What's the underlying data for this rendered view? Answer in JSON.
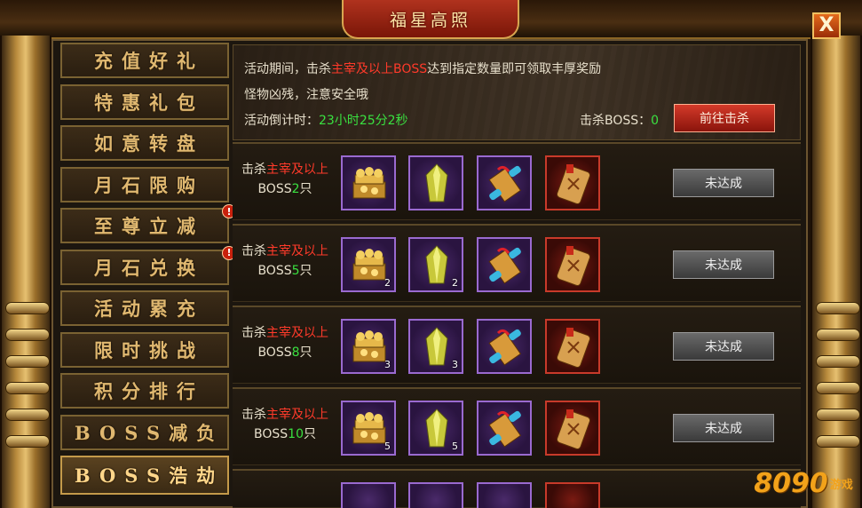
{
  "title": "福星高照",
  "close_label": "X",
  "sidebar": {
    "items": [
      {
        "label": "充值好礼",
        "alert": false,
        "active": false
      },
      {
        "label": "特惠礼包",
        "alert": false,
        "active": false
      },
      {
        "label": "如意转盘",
        "alert": false,
        "active": false
      },
      {
        "label": "月石限购",
        "alert": false,
        "active": false
      },
      {
        "label": "至尊立减",
        "alert": true,
        "active": false
      },
      {
        "label": "月石兑换",
        "alert": true,
        "active": false
      },
      {
        "label": "活动累充",
        "alert": false,
        "active": false
      },
      {
        "label": "限时挑战",
        "alert": false,
        "active": false
      },
      {
        "label": "积分排行",
        "alert": false,
        "active": false
      },
      {
        "label": "BOSS减负",
        "alert": false,
        "active": false
      },
      {
        "label": "BOSS浩劫",
        "alert": false,
        "active": true
      }
    ],
    "alert_glyph": "!"
  },
  "banner": {
    "line1_prefix": "活动期间，击杀",
    "line1_highlight": "主宰及以上BOSS",
    "line1_suffix": "达到指定数量即可领取丰厚奖励",
    "line2": "怪物凶残，注意安全哦",
    "countdown_label": "活动倒计时：",
    "countdown_value": "23小时25分2秒",
    "kill_label": "击杀BOSS：",
    "kill_value": "0",
    "go_button": "前往击杀"
  },
  "rows": [
    {
      "req_prefix": "击杀",
      "req_highlight": "主宰及以上",
      "req_boss": "BOSS",
      "count": "2",
      "unit": "只",
      "qty": [
        "",
        "",
        "",
        ""
      ],
      "status": "未达成"
    },
    {
      "req_prefix": "击杀",
      "req_highlight": "主宰及以上",
      "req_boss": "BOSS",
      "count": "5",
      "unit": "只",
      "qty": [
        "2",
        "2",
        "",
        ""
      ],
      "status": "未达成"
    },
    {
      "req_prefix": "击杀",
      "req_highlight": "主宰及以上",
      "req_boss": "BOSS",
      "count": "8",
      "unit": "只",
      "qty": [
        "3",
        "3",
        "",
        ""
      ],
      "status": "未达成"
    },
    {
      "req_prefix": "击杀",
      "req_highlight": "主宰及以上",
      "req_boss": "BOSS",
      "count": "10",
      "unit": "只",
      "qty": [
        "5",
        "5",
        "",
        ""
      ],
      "status": "未达成"
    }
  ],
  "reward_icons": [
    "gold-chest-icon",
    "yellow-crystal-icon",
    "scroll-icon",
    "talisman-icon"
  ],
  "colors": {
    "highlight_red": "#ff3a2a",
    "highlight_green": "#3ae040",
    "gold": "#e0b870"
  },
  "logo": {
    "number": "8090",
    "text": "游戏"
  }
}
